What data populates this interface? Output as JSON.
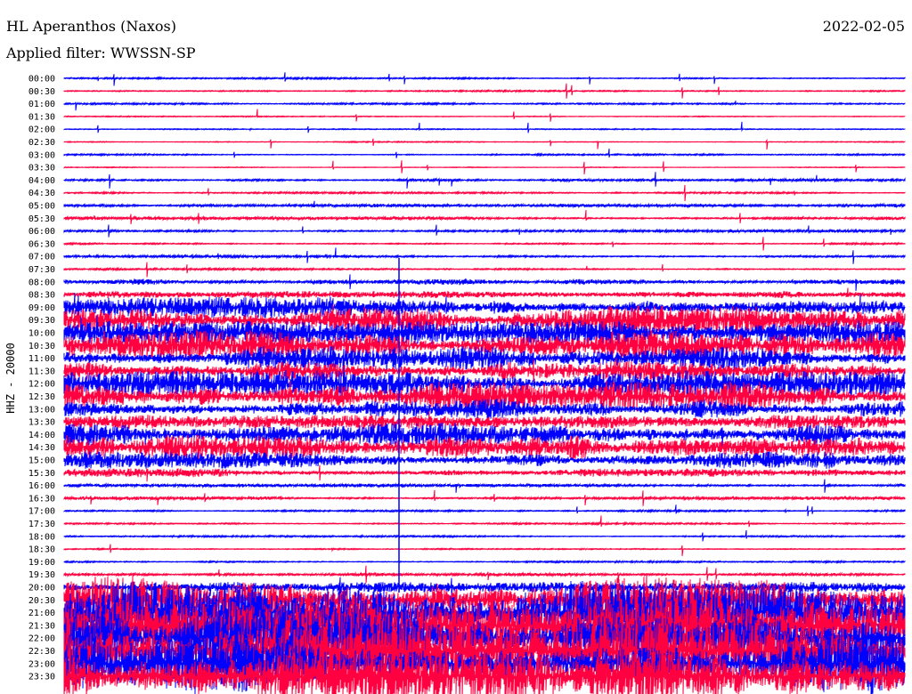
{
  "header": {
    "station": "HL Aperanthos (Naxos)",
    "filter": "Applied filter: WWSSN-SP",
    "date": "2022-02-05"
  },
  "chart_data": {
    "type": "line",
    "title": "HL Aperanthos (Naxos)",
    "subtitle": "Applied filter: WWSSN-SP",
    "ylabel": "HHZ - 20000",
    "row_labels": [
      "00:00",
      "00:30",
      "01:00",
      "01:30",
      "02:00",
      "02:30",
      "03:00",
      "03:30",
      "04:00",
      "04:30",
      "05:00",
      "05:30",
      "06:00",
      "06:30",
      "07:00",
      "07:30",
      "08:00",
      "08:30",
      "09:00",
      "09:30",
      "10:00",
      "10:30",
      "11:00",
      "11:30",
      "12:00",
      "12:30",
      "13:00",
      "13:30",
      "14:00",
      "14:30",
      "15:00",
      "15:30",
      "16:00",
      "16:30",
      "17:00",
      "17:30",
      "18:00",
      "18:30",
      "19:00",
      "19:30",
      "20:00",
      "20:30",
      "21:00",
      "21:30",
      "22:00",
      "22:30",
      "23:00",
      "23:30"
    ],
    "relative_amplitude": [
      0.05,
      0.05,
      0.05,
      0.03,
      0.03,
      0.03,
      0.05,
      0.03,
      0.08,
      0.05,
      0.1,
      0.1,
      0.08,
      0.06,
      0.08,
      0.06,
      0.2,
      0.2,
      0.6,
      0.8,
      0.7,
      0.9,
      0.7,
      0.6,
      0.8,
      0.9,
      0.6,
      0.4,
      0.8,
      0.9,
      0.5,
      0.25,
      0.1,
      0.1,
      0.05,
      0.05,
      0.05,
      0.05,
      0.05,
      0.1,
      0.3,
      1.4,
      1.8,
      1.8,
      1.8,
      1.8,
      1.9,
      1.9
    ],
    "colors": [
      "#0000ff",
      "#ff0040"
    ]
  }
}
